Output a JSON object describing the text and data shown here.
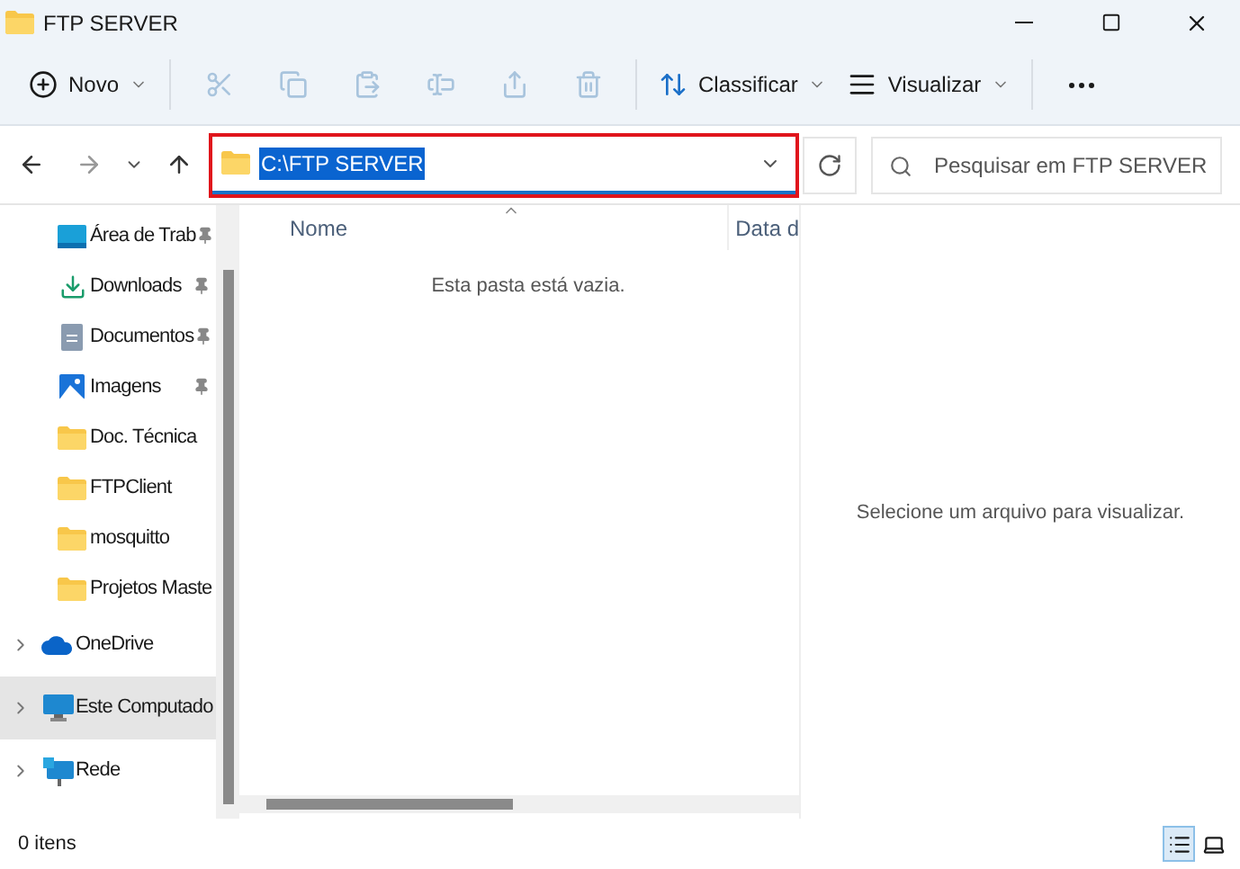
{
  "window": {
    "title": "FTP SERVER"
  },
  "toolbar": {
    "groups": [
      [
        {
          "kind": "menu",
          "label": "Novo",
          "disabled": false
        }
      ],
      [
        {
          "kind": "cut",
          "disabled": true
        },
        {
          "kind": "copy",
          "disabled": true
        },
        {
          "kind": "paste",
          "disabled": true
        },
        {
          "kind": "rename",
          "disabled": true
        },
        {
          "kind": "share",
          "disabled": true
        },
        {
          "kind": "delete",
          "disabled": true
        }
      ],
      [
        {
          "kind": "sort",
          "label": "Classificar",
          "disabled": false
        },
        {
          "kind": "view",
          "label": "Visualizar",
          "disabled": false
        }
      ],
      [
        {
          "kind": "more",
          "disabled": false
        }
      ]
    ]
  },
  "navigation": {
    "back_disabled": false,
    "forward_disabled": true
  },
  "address": {
    "path": "C:\\FTP SERVER",
    "text_selected": true,
    "highlighted": true
  },
  "search": {
    "placeholder": "Pesquisar em FTP SERVER"
  },
  "sidebar": {
    "items": [
      {
        "kind": "desktop",
        "label": "Área de Trab",
        "pinned": true,
        "expandable": false,
        "selected": false
      },
      {
        "kind": "download",
        "label": "Downloads",
        "pinned": true,
        "expandable": false,
        "selected": false
      },
      {
        "kind": "document",
        "label": "Documentos",
        "pinned": true,
        "expandable": false,
        "selected": false
      },
      {
        "kind": "image",
        "label": "Imagens",
        "pinned": true,
        "expandable": false,
        "selected": false
      },
      {
        "kind": "folder",
        "label": "Doc. Técnica",
        "pinned": false,
        "expandable": false,
        "selected": false
      },
      {
        "kind": "folder",
        "label": "FTPClient",
        "pinned": false,
        "expandable": false,
        "selected": false
      },
      {
        "kind": "folder",
        "label": "mosquitto",
        "pinned": false,
        "expandable": false,
        "selected": false
      },
      {
        "kind": "folder",
        "label": "Projetos Maste",
        "pinned": false,
        "expandable": false,
        "selected": false
      },
      {
        "kind": "cloud",
        "label": "OneDrive",
        "pinned": false,
        "expandable": true,
        "selected": false
      },
      {
        "kind": "computer",
        "label": "Este Computado",
        "pinned": false,
        "expandable": true,
        "selected": true
      },
      {
        "kind": "network",
        "label": "Rede",
        "pinned": false,
        "expandable": true,
        "selected": false
      }
    ]
  },
  "table": {
    "columns": [
      "Nome",
      "Data d"
    ],
    "empty_message": "Esta pasta está vazia."
  },
  "preview": {
    "message": "Selecione um arquivo para visualizar."
  },
  "status_bar": {
    "count": "0 itens",
    "views": [
      {
        "kind": "details",
        "selected": true
      },
      {
        "kind": "tiles",
        "selected": false
      }
    ]
  }
}
